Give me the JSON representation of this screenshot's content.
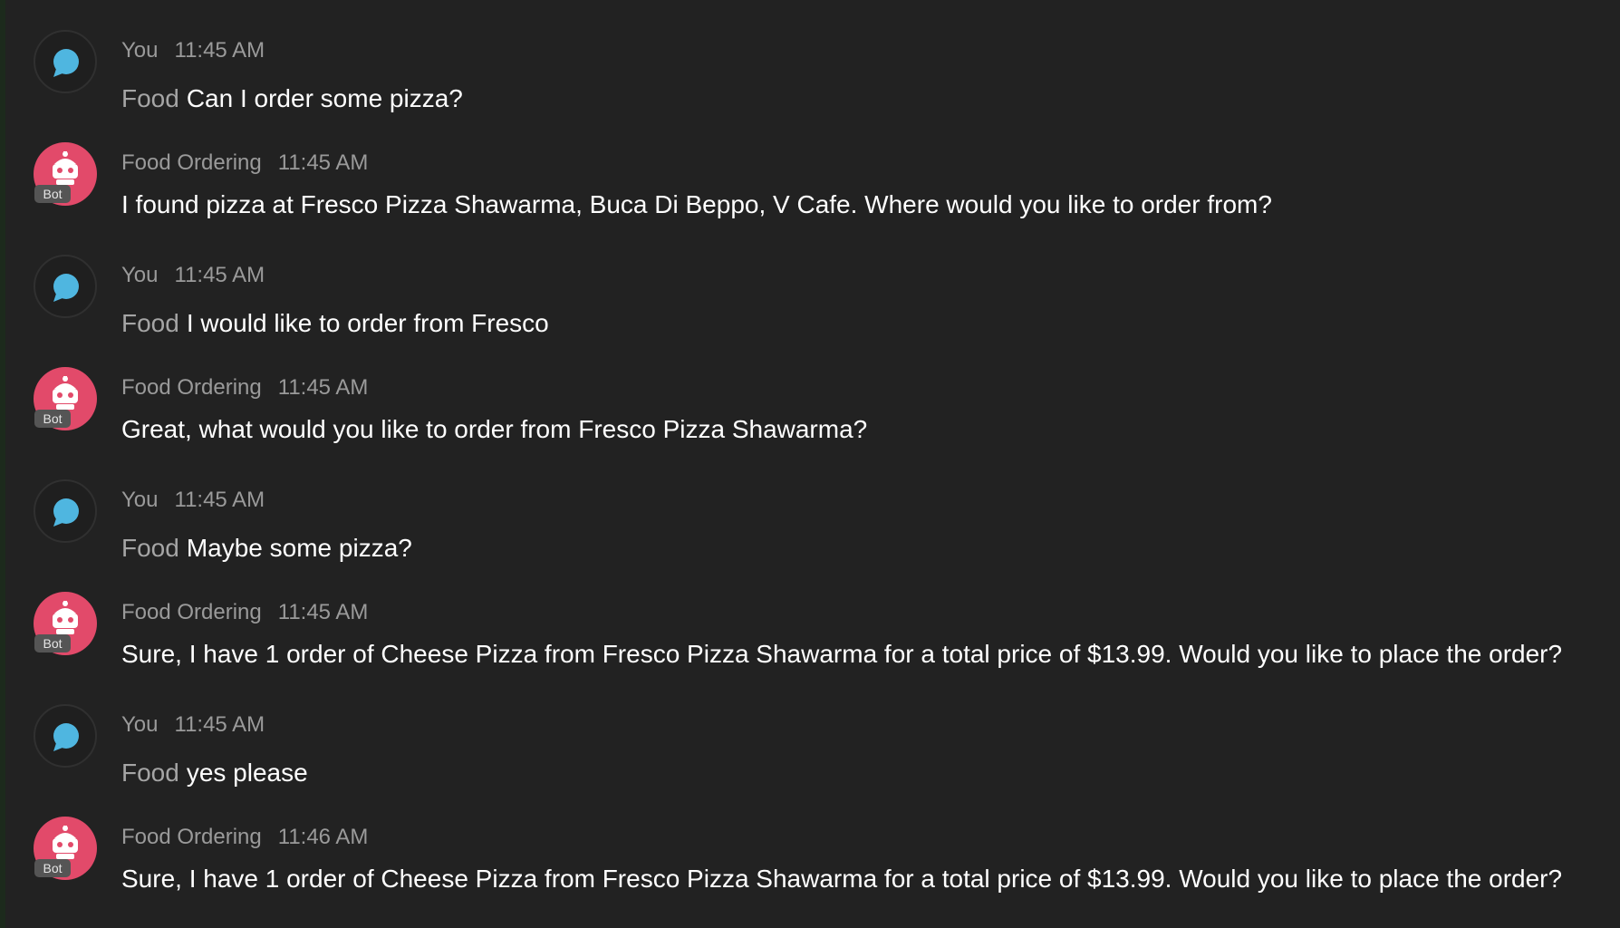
{
  "colors": {
    "background": "#222222",
    "user_bubble_icon": "#4fb6e0",
    "bot_avatar": "#e24a6a",
    "meta_text": "#9a9a9a",
    "message_text": "#ffffff"
  },
  "messages": [
    {
      "author": "You",
      "time": "11:45 AM",
      "prefix": "Food",
      "text": "Can I order some pizza?",
      "avatar": "chat-bubble-icon"
    },
    {
      "author": "Food Ordering",
      "time": "11:45 AM",
      "badge": "Bot",
      "text": "I found pizza at Fresco Pizza Shawarma, Buca Di Beppo, V Cafe. Where would you like to order from?",
      "avatar": "robot-icon"
    },
    {
      "author": "You",
      "time": "11:45 AM",
      "prefix": "Food",
      "text": "I would like to order from Fresco",
      "avatar": "chat-bubble-icon"
    },
    {
      "author": "Food Ordering",
      "time": "11:45 AM",
      "badge": "Bot",
      "text": "Great, what would you like to order from Fresco Pizza Shawarma?",
      "avatar": "robot-icon"
    },
    {
      "author": "You",
      "time": "11:45 AM",
      "prefix": "Food",
      "text": "Maybe some pizza?",
      "avatar": "chat-bubble-icon"
    },
    {
      "author": "Food Ordering",
      "time": "11:45 AM",
      "badge": "Bot",
      "text": "Sure, I have 1 order of Cheese Pizza from Fresco Pizza Shawarma for a total price of $13.99. Would you like to place the order?",
      "avatar": "robot-icon"
    },
    {
      "author": "You",
      "time": "11:45 AM",
      "prefix": "Food",
      "text": "yes please",
      "avatar": "chat-bubble-icon"
    },
    {
      "author": "Food Ordering",
      "time": "11:46 AM",
      "badge": "Bot",
      "text": "Sure, I have 1 order of Cheese Pizza from Fresco Pizza Shawarma for a total price of $13.99. Would you like to place the order?",
      "avatar": "robot-icon"
    }
  ]
}
